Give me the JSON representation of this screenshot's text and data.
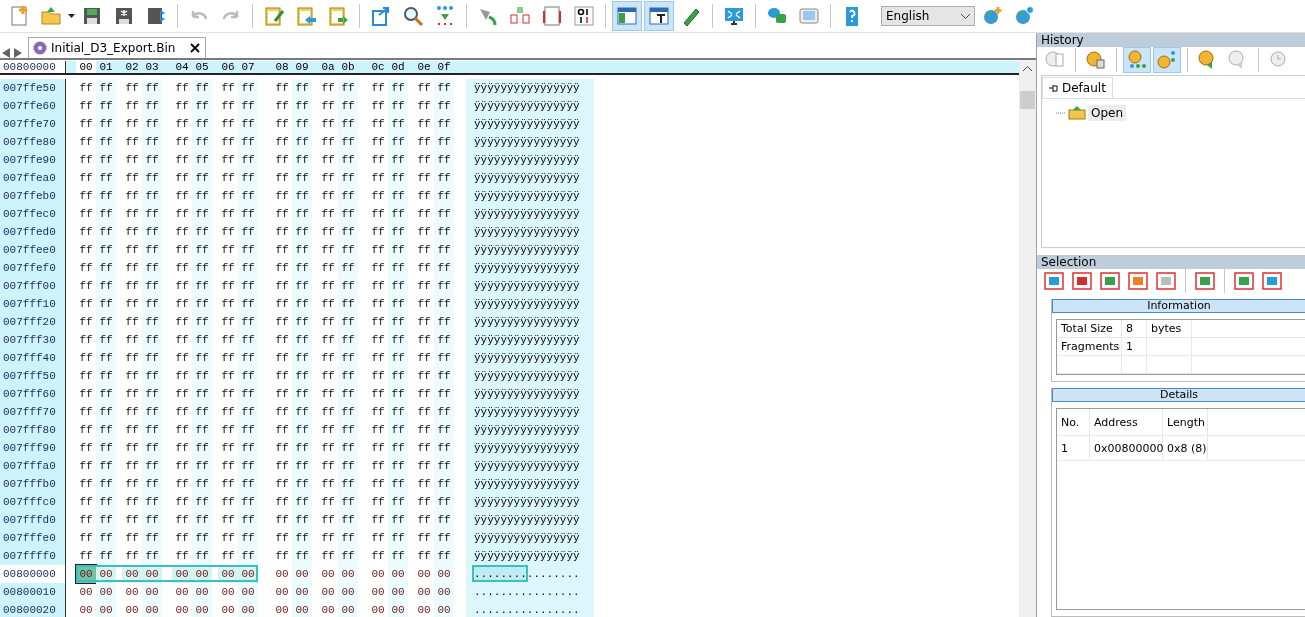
{
  "toolbar": {
    "buttons": [
      {
        "pressed": false
      },
      {
        "pressed": false
      },
      {
        "pressed": false
      },
      {
        "pressed": false
      },
      {
        "pressed": false
      },
      {
        "pressed": false
      },
      {
        "pressed": false
      },
      {
        "pressed": false
      },
      {
        "pressed": false
      },
      {
        "pressed": false
      },
      {
        "pressed": false
      },
      {
        "pressed": false
      },
      {
        "pressed": false
      },
      {
        "pressed": false
      },
      {
        "pressed": false
      },
      {
        "pressed": false
      },
      {
        "pressed": false
      },
      {
        "pressed": true
      },
      {
        "pressed": true
      },
      {
        "pressed": false
      },
      {
        "pressed": false
      },
      {
        "pressed": false
      },
      {
        "pressed": false
      },
      {
        "pressed": false
      }
    ],
    "language": "English"
  },
  "tab": {
    "label": "Initial_D3_Export.Bin",
    "selected": true
  },
  "hex_view": {
    "header_address": "00800000",
    "columns": [
      "00",
      "01",
      "02",
      "03",
      "04",
      "05",
      "06",
      "07",
      "08",
      "09",
      "0a",
      "0b",
      "0c",
      "0d",
      "0e",
      "0f"
    ],
    "rows": [
      {
        "address": "007ffe50",
        "bytes": "ff ff ff ff ff ff ff ff ff ff ff ff ff ff ff ff",
        "ascii": "ÿÿÿÿÿÿÿÿÿÿÿÿÿÿÿÿ",
        "selected": false
      },
      {
        "address": "007ffe60",
        "bytes": "ff ff ff ff ff ff ff ff ff ff ff ff ff ff ff ff",
        "ascii": "ÿÿÿÿÿÿÿÿÿÿÿÿÿÿÿÿ",
        "selected": false
      },
      {
        "address": "007ffe70",
        "bytes": "ff ff ff ff ff ff ff ff ff ff ff ff ff ff ff ff",
        "ascii": "ÿÿÿÿÿÿÿÿÿÿÿÿÿÿÿÿ",
        "selected": false
      },
      {
        "address": "007ffe80",
        "bytes": "ff ff ff ff ff ff ff ff ff ff ff ff ff ff ff ff",
        "ascii": "ÿÿÿÿÿÿÿÿÿÿÿÿÿÿÿÿ",
        "selected": false
      },
      {
        "address": "007ffe90",
        "bytes": "ff ff ff ff ff ff ff ff ff ff ff ff ff ff ff ff",
        "ascii": "ÿÿÿÿÿÿÿÿÿÿÿÿÿÿÿÿ",
        "selected": false
      },
      {
        "address": "007ffea0",
        "bytes": "ff ff ff ff ff ff ff ff ff ff ff ff ff ff ff ff",
        "ascii": "ÿÿÿÿÿÿÿÿÿÿÿÿÿÿÿÿ",
        "selected": false
      },
      {
        "address": "007ffeb0",
        "bytes": "ff ff ff ff ff ff ff ff ff ff ff ff ff ff ff ff",
        "ascii": "ÿÿÿÿÿÿÿÿÿÿÿÿÿÿÿÿ",
        "selected": false
      },
      {
        "address": "007ffec0",
        "bytes": "ff ff ff ff ff ff ff ff ff ff ff ff ff ff ff ff",
        "ascii": "ÿÿÿÿÿÿÿÿÿÿÿÿÿÿÿÿ",
        "selected": false
      },
      {
        "address": "007ffed0",
        "bytes": "ff ff ff ff ff ff ff ff ff ff ff ff ff ff ff ff",
        "ascii": "ÿÿÿÿÿÿÿÿÿÿÿÿÿÿÿÿ",
        "selected": false
      },
      {
        "address": "007ffee0",
        "bytes": "ff ff ff ff ff ff ff ff ff ff ff ff ff ff ff ff",
        "ascii": "ÿÿÿÿÿÿÿÿÿÿÿÿÿÿÿÿ",
        "selected": false
      },
      {
        "address": "007ffef0",
        "bytes": "ff ff ff ff ff ff ff ff ff ff ff ff ff ff ff ff",
        "ascii": "ÿÿÿÿÿÿÿÿÿÿÿÿÿÿÿÿ",
        "selected": false
      },
      {
        "address": "007fff00",
        "bytes": "ff ff ff ff ff ff ff ff ff ff ff ff ff ff ff ff",
        "ascii": "ÿÿÿÿÿÿÿÿÿÿÿÿÿÿÿÿ",
        "selected": false
      },
      {
        "address": "007fff10",
        "bytes": "ff ff ff ff ff ff ff ff ff ff ff ff ff ff ff ff",
        "ascii": "ÿÿÿÿÿÿÿÿÿÿÿÿÿÿÿÿ",
        "selected": false
      },
      {
        "address": "007fff20",
        "bytes": "ff ff ff ff ff ff ff ff ff ff ff ff ff ff ff ff",
        "ascii": "ÿÿÿÿÿÿÿÿÿÿÿÿÿÿÿÿ",
        "selected": false
      },
      {
        "address": "007fff30",
        "bytes": "ff ff ff ff ff ff ff ff ff ff ff ff ff ff ff ff",
        "ascii": "ÿÿÿÿÿÿÿÿÿÿÿÿÿÿÿÿ",
        "selected": false
      },
      {
        "address": "007fff40",
        "bytes": "ff ff ff ff ff ff ff ff ff ff ff ff ff ff ff ff",
        "ascii": "ÿÿÿÿÿÿÿÿÿÿÿÿÿÿÿÿ",
        "selected": false
      },
      {
        "address": "007fff50",
        "bytes": "ff ff ff ff ff ff ff ff ff ff ff ff ff ff ff ff",
        "ascii": "ÿÿÿÿÿÿÿÿÿÿÿÿÿÿÿÿ",
        "selected": false
      },
      {
        "address": "007fff60",
        "bytes": "ff ff ff ff ff ff ff ff ff ff ff ff ff ff ff ff",
        "ascii": "ÿÿÿÿÿÿÿÿÿÿÿÿÿÿÿÿ",
        "selected": false
      },
      {
        "address": "007fff70",
        "bytes": "ff ff ff ff ff ff ff ff ff ff ff ff ff ff ff ff",
        "ascii": "ÿÿÿÿÿÿÿÿÿÿÿÿÿÿÿÿ",
        "selected": false
      },
      {
        "address": "007fff80",
        "bytes": "ff ff ff ff ff ff ff ff ff ff ff ff ff ff ff ff",
        "ascii": "ÿÿÿÿÿÿÿÿÿÿÿÿÿÿÿÿ",
        "selected": false
      },
      {
        "address": "007fff90",
        "bytes": "ff ff ff ff ff ff ff ff ff ff ff ff ff ff ff ff",
        "ascii": "ÿÿÿÿÿÿÿÿÿÿÿÿÿÿÿÿ",
        "selected": false
      },
      {
        "address": "007fffa0",
        "bytes": "ff ff ff ff ff ff ff ff ff ff ff ff ff ff ff ff",
        "ascii": "ÿÿÿÿÿÿÿÿÿÿÿÿÿÿÿÿ",
        "selected": false
      },
      {
        "address": "007fffb0",
        "bytes": "ff ff ff ff ff ff ff ff ff ff ff ff ff ff ff ff",
        "ascii": "ÿÿÿÿÿÿÿÿÿÿÿÿÿÿÿÿ",
        "selected": false
      },
      {
        "address": "007fffc0",
        "bytes": "ff ff ff ff ff ff ff ff ff ff ff ff ff ff ff ff",
        "ascii": "ÿÿÿÿÿÿÿÿÿÿÿÿÿÿÿÿ",
        "selected": false
      },
      {
        "address": "007fffd0",
        "bytes": "ff ff ff ff ff ff ff ff ff ff ff ff ff ff ff ff",
        "ascii": "ÿÿÿÿÿÿÿÿÿÿÿÿÿÿÿÿ",
        "selected": false
      },
      {
        "address": "007fffe0",
        "bytes": "ff ff ff ff ff ff ff ff ff ff ff ff ff ff ff ff",
        "ascii": "ÿÿÿÿÿÿÿÿÿÿÿÿÿÿÿÿ",
        "selected": false
      },
      {
        "address": "007ffff0",
        "bytes": "ff ff ff ff ff ff ff ff ff ff ff ff ff ff ff ff",
        "ascii": "ÿÿÿÿÿÿÿÿÿÿÿÿÿÿÿÿ",
        "selected": false
      },
      {
        "address": "00800000",
        "bytes": "00 00 00 00 00 00 00 00 00 00 00 00 00 00 00 00",
        "ascii": "................",
        "selected": true
      },
      {
        "address": "00800010",
        "bytes": "00 00 00 00 00 00 00 00 00 00 00 00 00 00 00 00",
        "ascii": "................",
        "selected": false
      },
      {
        "address": "00800020",
        "bytes": "00 00 00 00 00 00 00 00 00 00 00 00 00 00 00 00",
        "ascii": "................",
        "selected": false
      }
    ]
  },
  "history": {
    "title": "History",
    "toolbar": [
      {
        "pressed": false
      },
      {
        "pressed": false
      },
      {
        "pressed": true
      },
      {
        "pressed": true
      },
      {
        "pressed": false
      },
      {
        "pressed": false
      },
      {
        "pressed": false
      }
    ],
    "tab": {
      "label": "Default",
      "selected": true
    },
    "items": [
      {
        "label": "Open",
        "selected": true
      }
    ]
  },
  "selection": {
    "title": "Selection",
    "information": {
      "title": "Information",
      "rows": [
        [
          "Total Size",
          "8",
          "bytes"
        ],
        [
          "Fragments",
          "1",
          ""
        ]
      ]
    },
    "details": {
      "title": "Details",
      "columns": [
        "No.",
        "Address",
        "Length"
      ],
      "rows": [
        [
          "1",
          "0x00800000",
          "0x8 (8)"
        ]
      ]
    }
  }
}
